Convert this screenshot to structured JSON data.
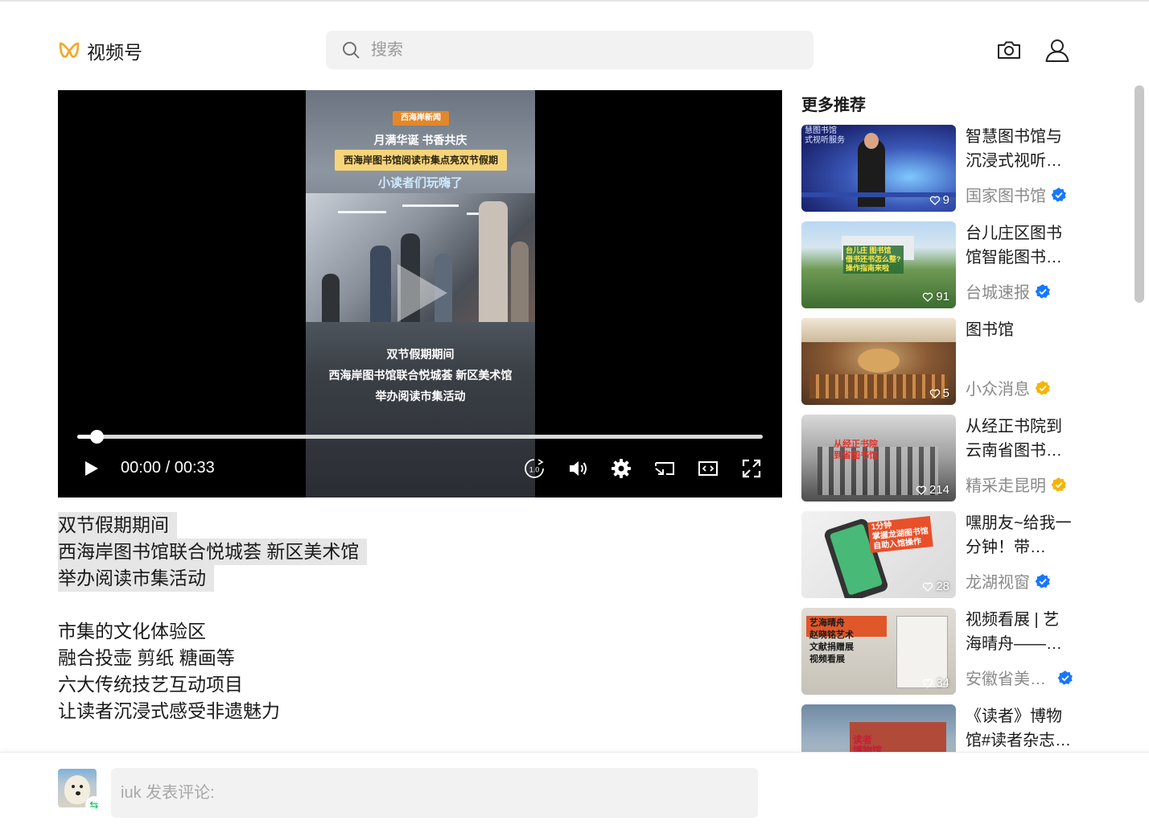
{
  "header": {
    "app_name": "视频号",
    "search_placeholder": "搜索"
  },
  "player": {
    "overlay": {
      "brand_badge": "西海岸新闻",
      "headline": "月满华诞 书香共庆",
      "yellow_banner": "西海岸图书馆阅读市集点亮双节假期",
      "blue_caption": "小读者们玩嗨了",
      "subtitle_lines": [
        "双节假期期间",
        "西海岸图书馆联合悦城荟 新区美术馆",
        "举办阅读市集活动"
      ]
    },
    "current_time": "00:00",
    "duration": "00:33",
    "time_display": "00:00 / 00:33",
    "progress_fraction": 0.028,
    "speed_label": "1.0"
  },
  "description": {
    "highlighted_lines": [
      "双节假期期间",
      "西海岸图书馆联合悦城荟 新区美术馆",
      "举办阅读市集活动"
    ],
    "lines": [
      "市集的文化体验区",
      "融合投壶 剪纸 糖画等",
      "六大传统技艺互动项目",
      "让读者沉浸式感受非遗魅力"
    ]
  },
  "sidebar": {
    "title": "更多推荐",
    "items": [
      {
        "title": "智慧图书馆与沉浸式视听…",
        "author": "国家图书馆",
        "likes": "9",
        "badge": "blue",
        "thumb_text": "慧图书馆\n式视听服务"
      },
      {
        "title": "台儿庄区图书馆智能图书…",
        "author": "台城速报",
        "likes": "91",
        "badge": "blue",
        "thumb_text": "台儿庄 图书馆\n借书还书怎么整?\n操作指南来啦"
      },
      {
        "title": "图书馆",
        "author": "小众消息",
        "likes": "5",
        "badge": "gold",
        "thumb_text": ""
      },
      {
        "title": "从经正书院到云南省图书…",
        "author": "精采走昆明",
        "likes": "214",
        "badge": "gold",
        "thumb_text": "从经正书院\n到省图书馆"
      },
      {
        "title": "嘿朋友~给我一分钟！带…",
        "author": "龙湖视窗",
        "likes": "28",
        "badge": "blue",
        "thumb_text": "1分钟\n掌握龙湖图书馆\n自助入馆操作"
      },
      {
        "title": "视频看展 | 艺海晴舟——…",
        "author": "安徽省美…",
        "likes": "34",
        "badge": "blue",
        "thumb_text": "艺海晴舟\n赵晓铭艺术\n文献捐赠展\n视频看展"
      },
      {
        "title": "《读者》博物馆#读者杂志…",
        "author": "",
        "likes": "",
        "badge": "",
        "thumb_text": "读者\n博物馆"
      }
    ]
  },
  "comment": {
    "placeholder": "iuk 发表评论:"
  },
  "colors": {
    "accent_logo": "#f6a623",
    "verified_blue": "#1677ff",
    "verified_gold": "#f5b400",
    "wechat_green": "#07c160"
  }
}
